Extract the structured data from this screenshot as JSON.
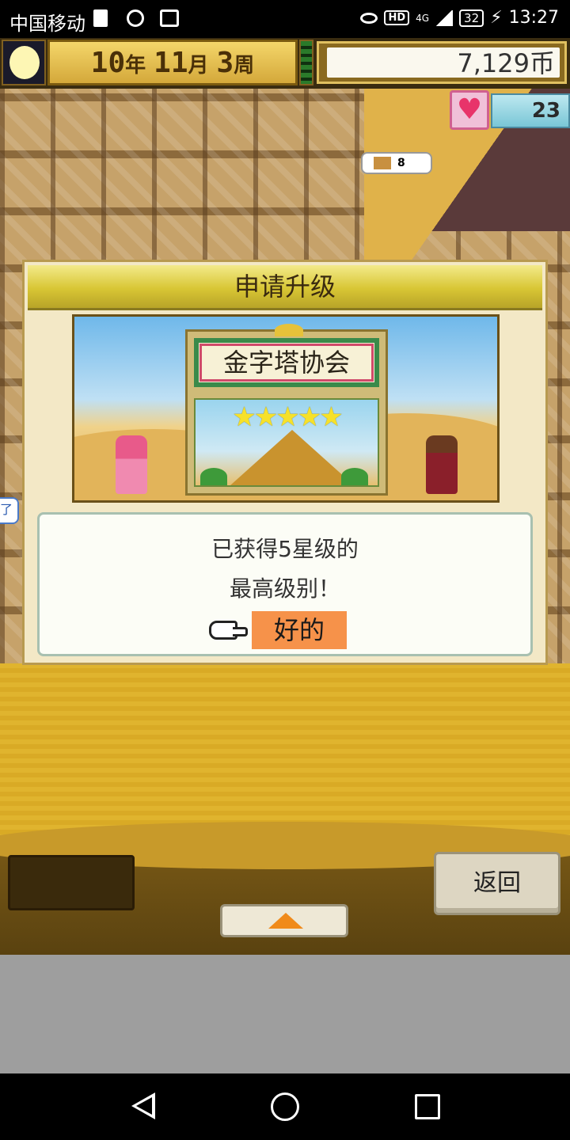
{
  "status_bar": {
    "carrier": "中国移动",
    "network_label": "HD",
    "signal_type": "4G",
    "battery": "32",
    "time": "13:27"
  },
  "hud": {
    "year_num": "10",
    "year_unit": "年",
    "month_num": "11",
    "month_unit": "月",
    "week_num": "3",
    "week_unit": "周",
    "money": "7,129币",
    "hearts": "23",
    "bubble_count": "8",
    "side_tag": "了"
  },
  "dialog": {
    "title": "申请升级",
    "association_name": "金字塔协会",
    "stars": "★★★★★",
    "star_rating": 5,
    "message_line1": "已获得5星级的",
    "message_line2": "最高级别！",
    "ok_label": "好的"
  },
  "controls": {
    "back_label": "返回"
  },
  "colors": {
    "ok_highlight": "#f6924a",
    "title_bar": "#d8c634",
    "sand": "#e0b42e"
  }
}
